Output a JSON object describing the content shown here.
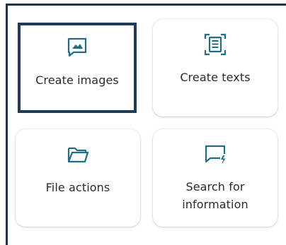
{
  "colors": {
    "icon": "#1f6e85",
    "selected_border": "#1f3a5c",
    "frame": "#1f3347",
    "label": "#2b2b2b"
  },
  "cards": [
    {
      "label": "Create images",
      "icon": "image-chat-icon",
      "selected": true
    },
    {
      "label": "Create texts",
      "icon": "document-scan-icon",
      "selected": false
    },
    {
      "label": "File actions",
      "icon": "folder-icon",
      "selected": false
    },
    {
      "label_line1": "Search for",
      "label_line2": "information",
      "icon": "chat-search-icon",
      "selected": false
    }
  ]
}
